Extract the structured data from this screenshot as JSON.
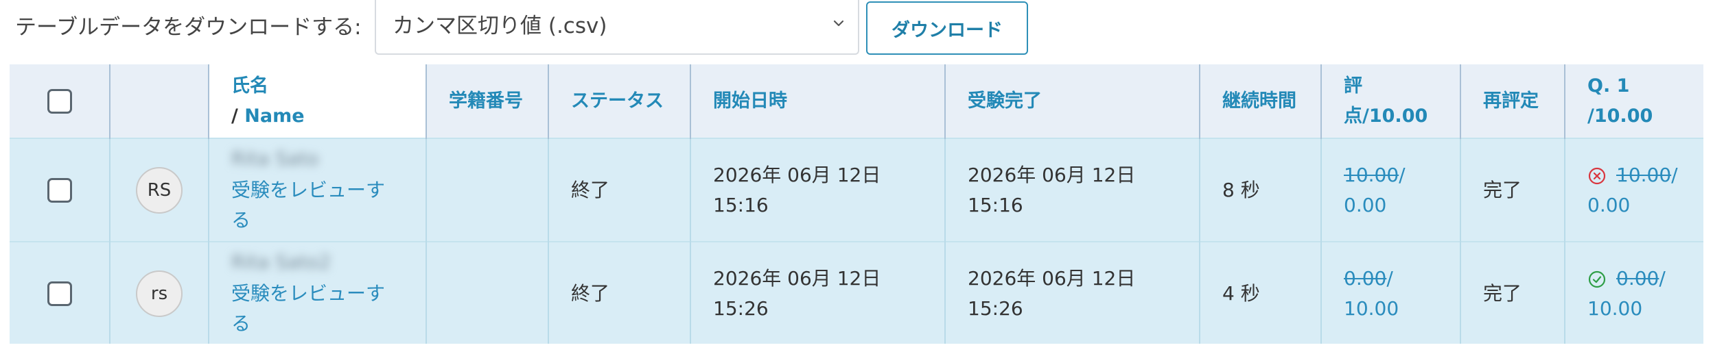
{
  "download": {
    "label": "テーブルデータをダウンロードする:",
    "format": "カンマ区切り値 (.csv)",
    "button": "ダウンロード"
  },
  "table": {
    "headers": {
      "name_ja": "氏名",
      "name_slash": "/",
      "name_en": "Name",
      "student_id": "学籍番号",
      "status": "ステータス",
      "started": "開始日時",
      "completed": "受験完了",
      "duration": "継続時間",
      "grade": "評点/10.00",
      "regrade": "再評定",
      "q1": "Q. 1 /10.00"
    },
    "rows": [
      {
        "initials": "RS",
        "name": "Rita Sato",
        "review": "受験をレビューする",
        "status": "終了",
        "started": "2026年 06月 12日 15:16",
        "completed": "2026年 06月 12日 15:16",
        "duration": "8 秒",
        "grade_old": "10.00",
        "grade_sep": "/",
        "grade_new": "0.00",
        "regrade": "完了",
        "q1_old": "10.00",
        "q1_sep": "/",
        "q1_new": "0.00",
        "q1_icon": "x-circle-icon"
      },
      {
        "initials": "rs",
        "name": "Rita Sato2",
        "review": "受験をレビューする",
        "status": "終了",
        "started": "2026年 06月 12日 15:26",
        "completed": "2026年 06月 12日 15:26",
        "duration": "4 秒",
        "grade_old": "0.00",
        "grade_sep": "/",
        "grade_new": "10.00",
        "regrade": "完了",
        "q1_old": "0.00",
        "q1_sep": "/",
        "q1_new": "10.00",
        "q1_icon": "check-circle-icon"
      }
    ]
  },
  "colors": {
    "accent": "#2a8cbd",
    "row_bg": "#d9edf6",
    "header_bg": "#e8eff7",
    "wrong": "#d9363e",
    "correct": "#2e9e46"
  }
}
